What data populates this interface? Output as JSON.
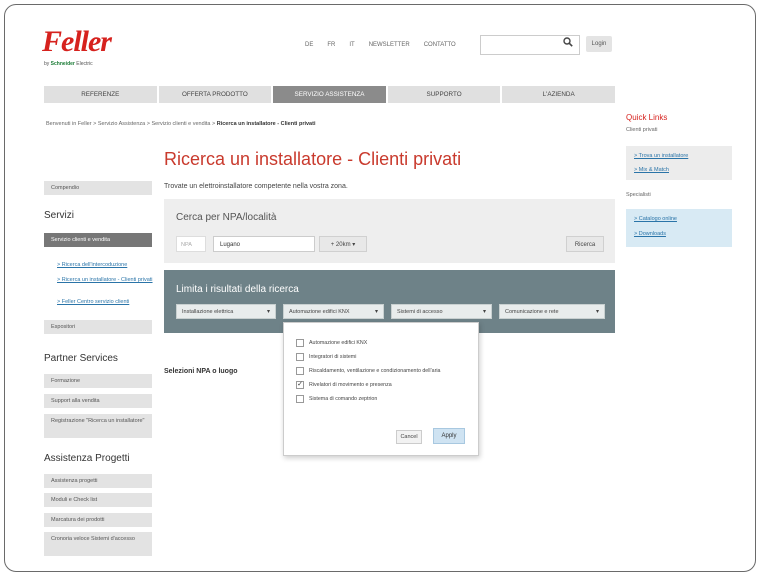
{
  "logo": {
    "brand": "Feller",
    "sub_prefix": "by",
    "sub_company": "Schneider",
    "sub_suffix": "Electric"
  },
  "toplinks": [
    "DE",
    "FR",
    "IT",
    "NEWSLETTER",
    "CONTATTO"
  ],
  "search": {
    "value": ""
  },
  "login_label": "Login",
  "nav": [
    "REFERENZE",
    "OFFERTA PRODOTTO",
    "SERVIZIO ASSISTENZA",
    "SUPPORTO",
    "L'AZIENDA"
  ],
  "nav_active": 2,
  "breadcrumb": {
    "path": "Benvenuti in Feller > Servizio Assistenza > Servizio clienti e vendita > ",
    "current": "Ricerca un installatore - Clienti privati"
  },
  "quicklinks": {
    "title": "Quick Links",
    "clienti_label": "Clienti privati",
    "clienti_links": [
      "> Trova un installatore",
      "> Mix & Match"
    ],
    "spec_label": "Specialisti",
    "spec_links": [
      "> Catalogo online",
      "> Downloads"
    ]
  },
  "main": {
    "title": "Ricerca un installatore - Clienti privati",
    "subtitle": "Trovate un elettroinstallatore competente nella vostra zona."
  },
  "sidebar": {
    "compendio": "Compendio",
    "servizi_title": "Servizi",
    "servizi_active": "Servizio clienti e vendita",
    "servizi_links": [
      "> Ricerca dell'intercoduzione",
      "> Ricerca un installatore - Clienti privati",
      "> Feller Centro servizio clienti"
    ],
    "espositori": "Espositori",
    "partner_title": "Partner Services",
    "partner_items": [
      "Formazione",
      "Support alla vendita",
      "Registrazione \"Ricerca un installatore\""
    ],
    "progetti_title": "Assistenza Progetti",
    "progetti_items": [
      "Assistenza progetti",
      "Moduli e Check list",
      "Marcatura dei prodotti",
      "Cronoria veloce Sistemi d'accesso"
    ]
  },
  "search_panel": {
    "title": "Cerca per NPA/località",
    "npa_placeholder": "NPA",
    "city_value": "Lugano",
    "km_value": "+ 20km",
    "km_caret": "▾",
    "ricerca_label": "Ricerca"
  },
  "filter_panel": {
    "title": "Limita i risultati della ricerca",
    "caret": "▾",
    "selects": [
      "Installazione elettrica",
      "Automazione edifici KNX",
      "Sistemi di accesso",
      "Comunicazione e rete"
    ]
  },
  "selection_label": "Selezioni NPA o luogo",
  "dropdown": {
    "options": [
      {
        "label": "Automazione edifici KNX",
        "checked": false
      },
      {
        "label": "Integratori di sistemi",
        "checked": false
      },
      {
        "label": "Riscaldamento, ventilazione e condizionamento dell'aria",
        "checked": false
      },
      {
        "label": "Rivelatori di movimento e presenza",
        "checked": true
      },
      {
        "label": "Sistema di comando zeptrion",
        "checked": false
      }
    ],
    "cancel_label": "Cancel",
    "apply_label": "Apply"
  }
}
